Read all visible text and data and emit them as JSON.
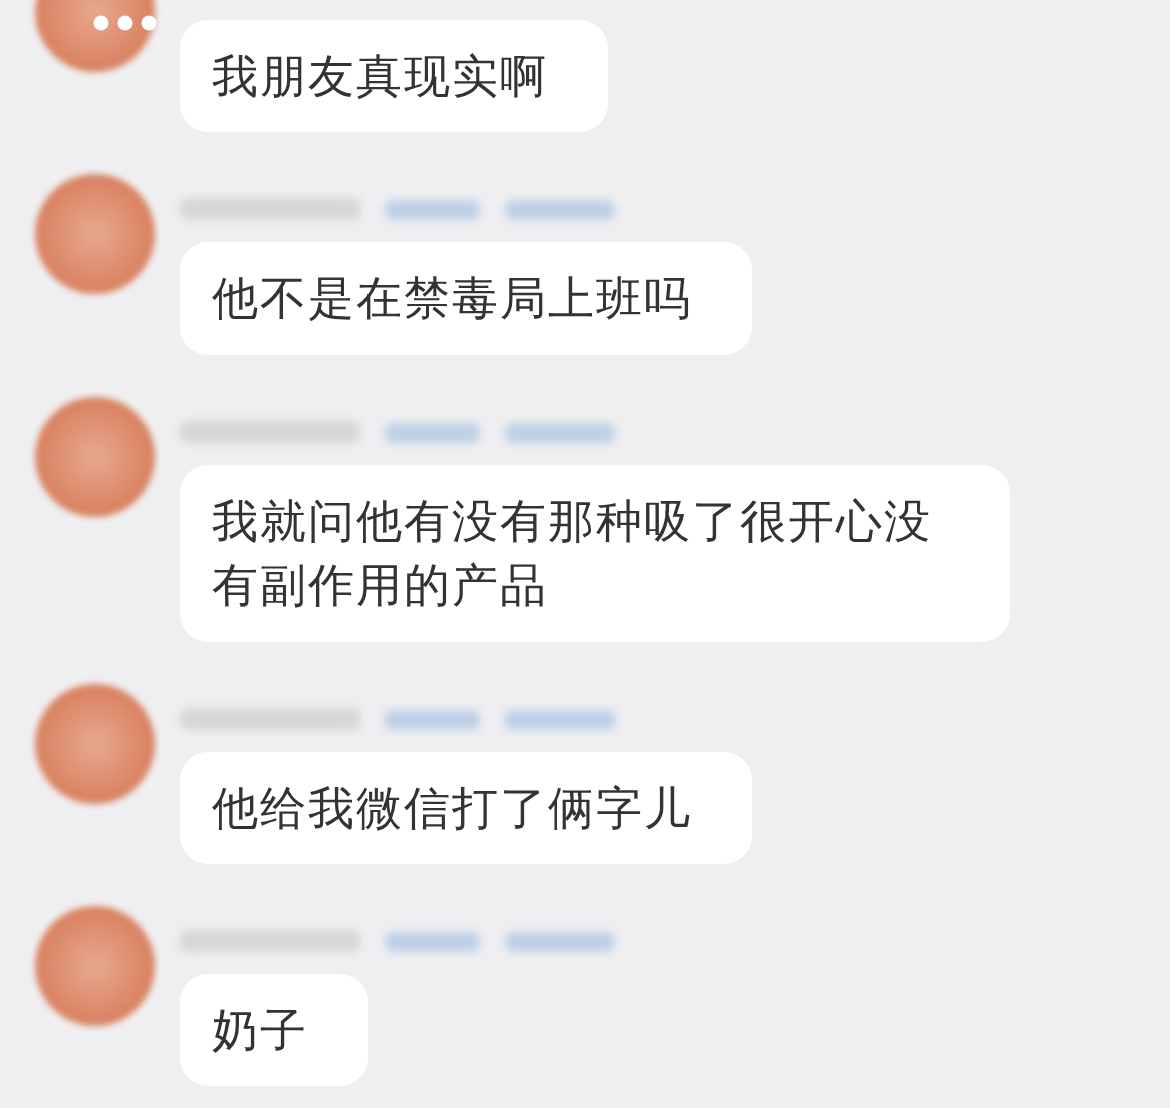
{
  "messages": [
    {
      "text": "我朋友真现实啊"
    },
    {
      "text": "他不是在禁毒局上班吗"
    },
    {
      "text": "我就问他有没有那种吸了很开心没有副作用的产品"
    },
    {
      "text": "他给我微信打了俩字儿"
    },
    {
      "text": "奶子"
    }
  ]
}
